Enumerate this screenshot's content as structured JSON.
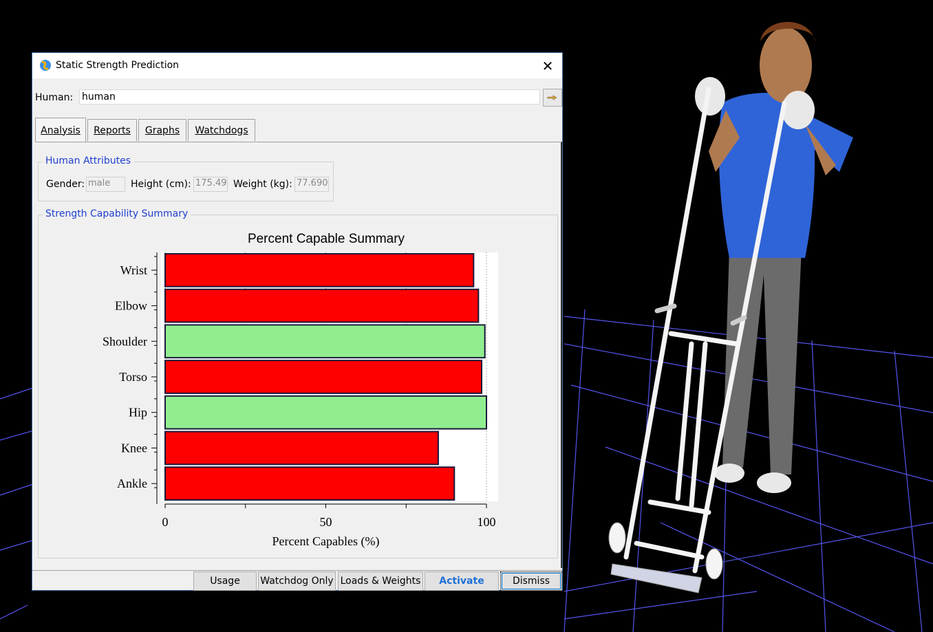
{
  "window": {
    "title": "Static Strength Prediction",
    "close_symbol": "✕"
  },
  "human": {
    "label": "Human:",
    "value": "human"
  },
  "tabs": [
    {
      "label": "Analysis",
      "active": true
    },
    {
      "label": "Reports",
      "active": false
    },
    {
      "label": "Graphs",
      "active": false
    },
    {
      "label": "Watchdogs",
      "active": false
    }
  ],
  "attributes": {
    "legend": "Human Attributes",
    "gender_label": "Gender:",
    "gender": "male",
    "height_label": "Height  (cm):",
    "height": "175.49",
    "weight_label": "Weight  (kg):",
    "weight": "77.690"
  },
  "summary": {
    "legend": "Strength Capability Summary"
  },
  "chart_data": {
    "type": "bar",
    "orientation": "horizontal",
    "title": "Percent Capable Summary",
    "xlabel": "Percent Capables (%)",
    "ylabel": "",
    "xlim": [
      0,
      100
    ],
    "xticks": [
      0,
      50,
      100
    ],
    "grid": true,
    "categories": [
      "Wrist",
      "Elbow",
      "Shoulder",
      "Torso",
      "Hip",
      "Knee",
      "Ankle"
    ],
    "values": [
      96,
      97.5,
      99.5,
      98.5,
      100,
      85,
      90
    ],
    "bar_colors": [
      "#ff0000",
      "#ff0000",
      "#90ee90",
      "#ff0000",
      "#90ee90",
      "#ff0000",
      "#ff0000"
    ]
  },
  "buttons": {
    "usage": "Usage",
    "watchdog_only": "Watchdog Only",
    "loads_weights": "Loads & Weights",
    "activate": "Activate",
    "dismiss": "Dismiss"
  },
  "colors": {
    "accent": "#2040d0",
    "fail": "#ff0000",
    "pass": "#90ee90",
    "grid": "#6666ff"
  }
}
